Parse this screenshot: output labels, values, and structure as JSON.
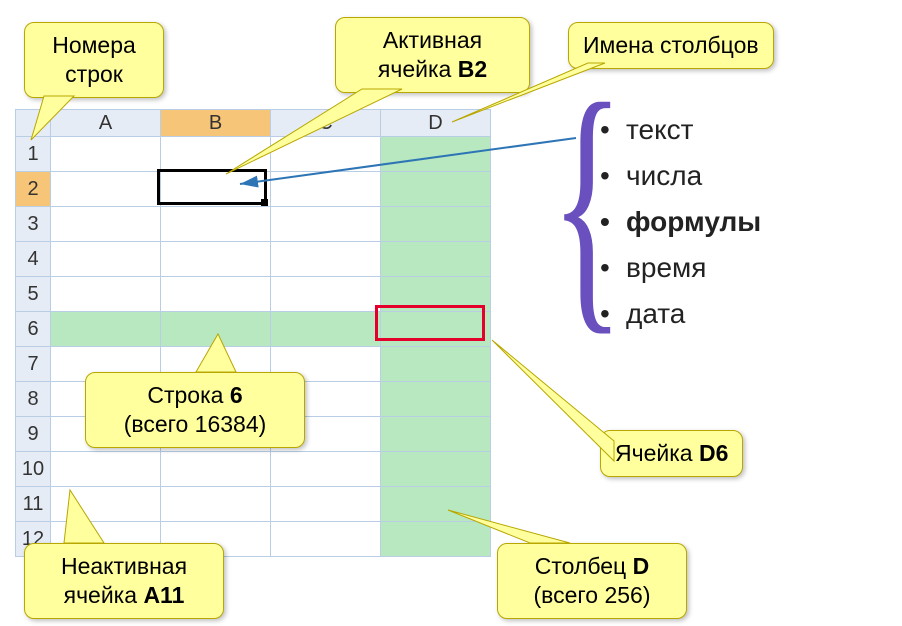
{
  "callouts": {
    "row_numbers": "Номера строк",
    "active_cell_prefix": "Активная ячейка ",
    "active_cell_ref": "B2",
    "column_names": "Имена столбцов",
    "row6_prefix": "Строка ",
    "row6_ref": "6",
    "row6_sub": "(всего 16384)",
    "cell_d6_prefix": "Ячейка ",
    "cell_d6_ref": "D6",
    "inactive_prefix": "Неактивная ячейка ",
    "inactive_ref": "A11",
    "column_d_prefix": "Столбец ",
    "column_d_ref": "D",
    "column_d_sub": "(всего 256)"
  },
  "grid": {
    "columns": [
      "A",
      "B",
      "C",
      "D"
    ],
    "rows": [
      "1",
      "2",
      "3",
      "4",
      "5",
      "6",
      "7",
      "8",
      "9",
      "10",
      "11",
      "12"
    ]
  },
  "bullets": {
    "items": [
      "текст",
      "числа",
      "формулы",
      "время",
      "дата"
    ],
    "bold_index": 2
  }
}
